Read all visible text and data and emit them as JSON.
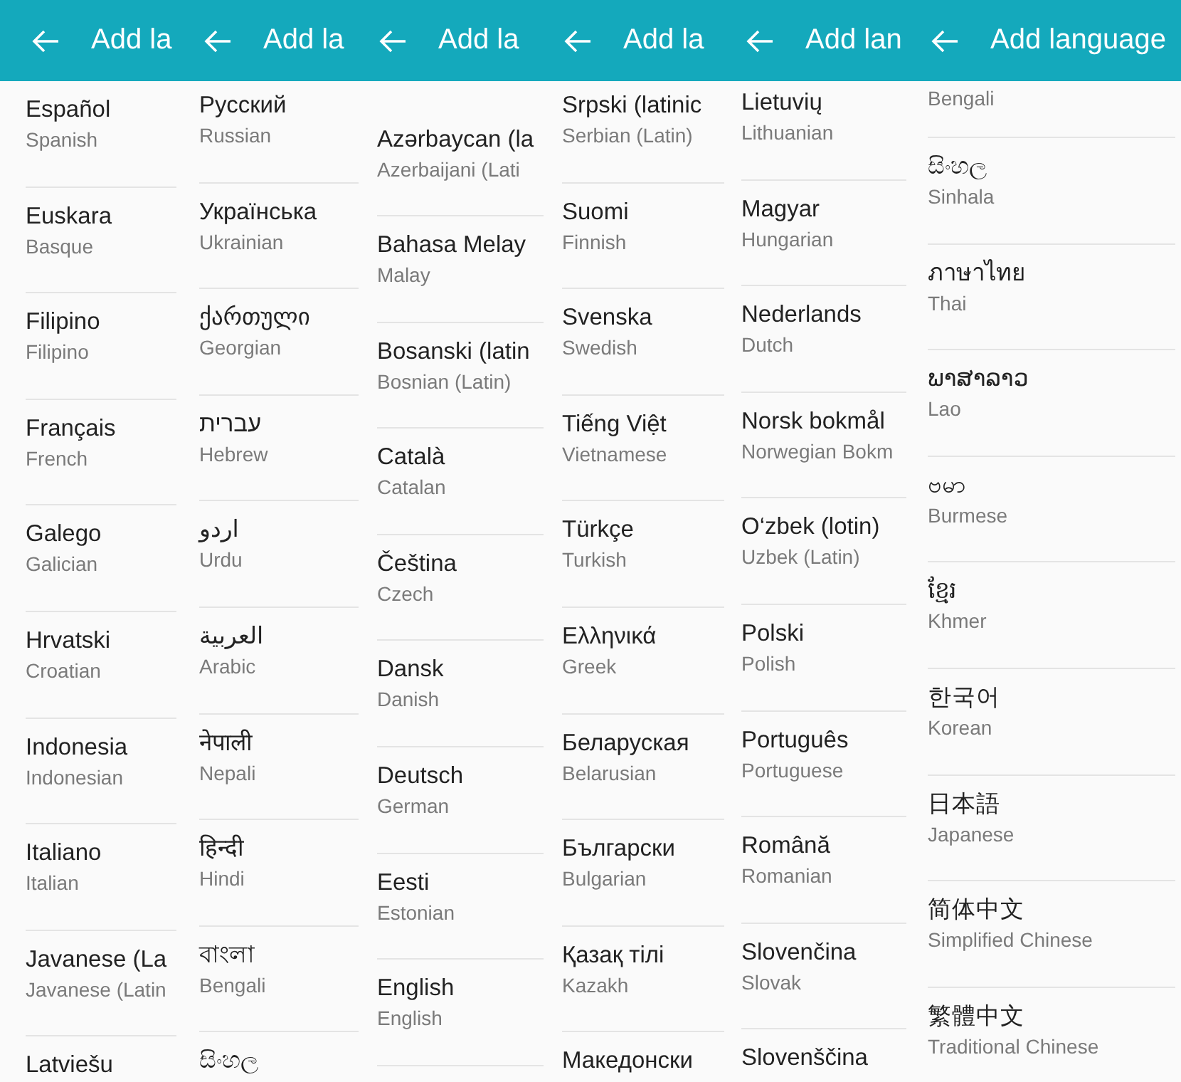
{
  "panels": [
    {
      "title": "Add la",
      "items": [
        {
          "name": "Español",
          "english": "Spanish"
        },
        {
          "name": "Euskara",
          "english": "Basque"
        },
        {
          "name": "Filipino",
          "english": "Filipino"
        },
        {
          "name": "Français",
          "english": "French"
        },
        {
          "name": "Galego",
          "english": "Galician"
        },
        {
          "name": "Hrvatski",
          "english": "Croatian"
        },
        {
          "name": "Indonesia",
          "english": "Indonesian"
        },
        {
          "name": "Italiano",
          "english": "Italian"
        },
        {
          "name": "Javanese (La",
          "english": "Javanese (Latin"
        },
        {
          "name": "Latviešu"
        }
      ]
    },
    {
      "title": "Add la",
      "items": [
        {
          "name": "Русский",
          "english": "Russian"
        },
        {
          "name": "Українська",
          "english": "Ukrainian"
        },
        {
          "name": "ქართული",
          "english": "Georgian"
        },
        {
          "name": "עברית",
          "english": "Hebrew"
        },
        {
          "name": "اردو",
          "english": "Urdu"
        },
        {
          "name": "العربية",
          "english": "Arabic"
        },
        {
          "name": "नेपाली",
          "english": "Nepali"
        },
        {
          "name": "हिन्दी",
          "english": "Hindi"
        },
        {
          "name": "বাংলা",
          "english": "Bengali"
        },
        {
          "name": "සිංහල"
        }
      ]
    },
    {
      "title": "Add la",
      "items": [
        {
          "name": "Azərbaycan (la",
          "english": "Azerbaijani (Lati"
        },
        {
          "name": "Bahasa Melay",
          "english": "Malay"
        },
        {
          "name": "Bosanski (latin",
          "english": "Bosnian (Latin)"
        },
        {
          "name": "Català",
          "english": "Catalan"
        },
        {
          "name": "Čeština",
          "english": "Czech"
        },
        {
          "name": "Dansk",
          "english": "Danish"
        },
        {
          "name": "Deutsch",
          "english": "German"
        },
        {
          "name": "Eesti",
          "english": "Estonian"
        },
        {
          "name": "English",
          "english": "English"
        }
      ]
    },
    {
      "title": "Add la",
      "items": [
        {
          "name": "Srpski (latinic",
          "english": "Serbian (Latin)"
        },
        {
          "name": "Suomi",
          "english": "Finnish"
        },
        {
          "name": "Svenska",
          "english": "Swedish"
        },
        {
          "name": "Tiếng Việt",
          "english": "Vietnamese"
        },
        {
          "name": "Türkçe",
          "english": "Turkish"
        },
        {
          "name": "Ελληνικά",
          "english": "Greek"
        },
        {
          "name": "Беларуская",
          "english": "Belarusian"
        },
        {
          "name": "Български",
          "english": "Bulgarian"
        },
        {
          "name": "Қазақ тілі",
          "english": "Kazakh"
        },
        {
          "name": "Македонски"
        }
      ]
    },
    {
      "title": "Add lan",
      "items": [
        {
          "name": "Lietuvių",
          "english": "Lithuanian"
        },
        {
          "name": "Magyar",
          "english": "Hungarian"
        },
        {
          "name": "Nederlands",
          "english": "Dutch"
        },
        {
          "name": "Norsk bokmål",
          "english": "Norwegian Bokm"
        },
        {
          "name": "O‘zbek (lotin)",
          "english": "Uzbek (Latin)"
        },
        {
          "name": "Polski",
          "english": "Polish"
        },
        {
          "name": "Português",
          "english": "Portuguese"
        },
        {
          "name": "Română",
          "english": "Romanian"
        },
        {
          "name": "Slovenčina",
          "english": "Slovak"
        },
        {
          "name": "Slovenščina"
        }
      ]
    },
    {
      "title": "Add language",
      "items": [
        {
          "english": "Bengali"
        },
        {
          "name": "සිංහල",
          "english": "Sinhala"
        },
        {
          "name": "ภาษาไทย",
          "english": "Thai"
        },
        {
          "name": "ພາສາລາວ",
          "english": "Lao"
        },
        {
          "name": "ဗမာ",
          "english": "Burmese"
        },
        {
          "name": "ខ្មែរ",
          "english": "Khmer"
        },
        {
          "name": "한국어",
          "english": "Korean"
        },
        {
          "name": "日本語",
          "english": "Japanese"
        },
        {
          "name": "简体中文",
          "english": "Simplified Chinese"
        },
        {
          "name": "繁體中文",
          "english": "Traditional Chinese"
        }
      ]
    }
  ]
}
